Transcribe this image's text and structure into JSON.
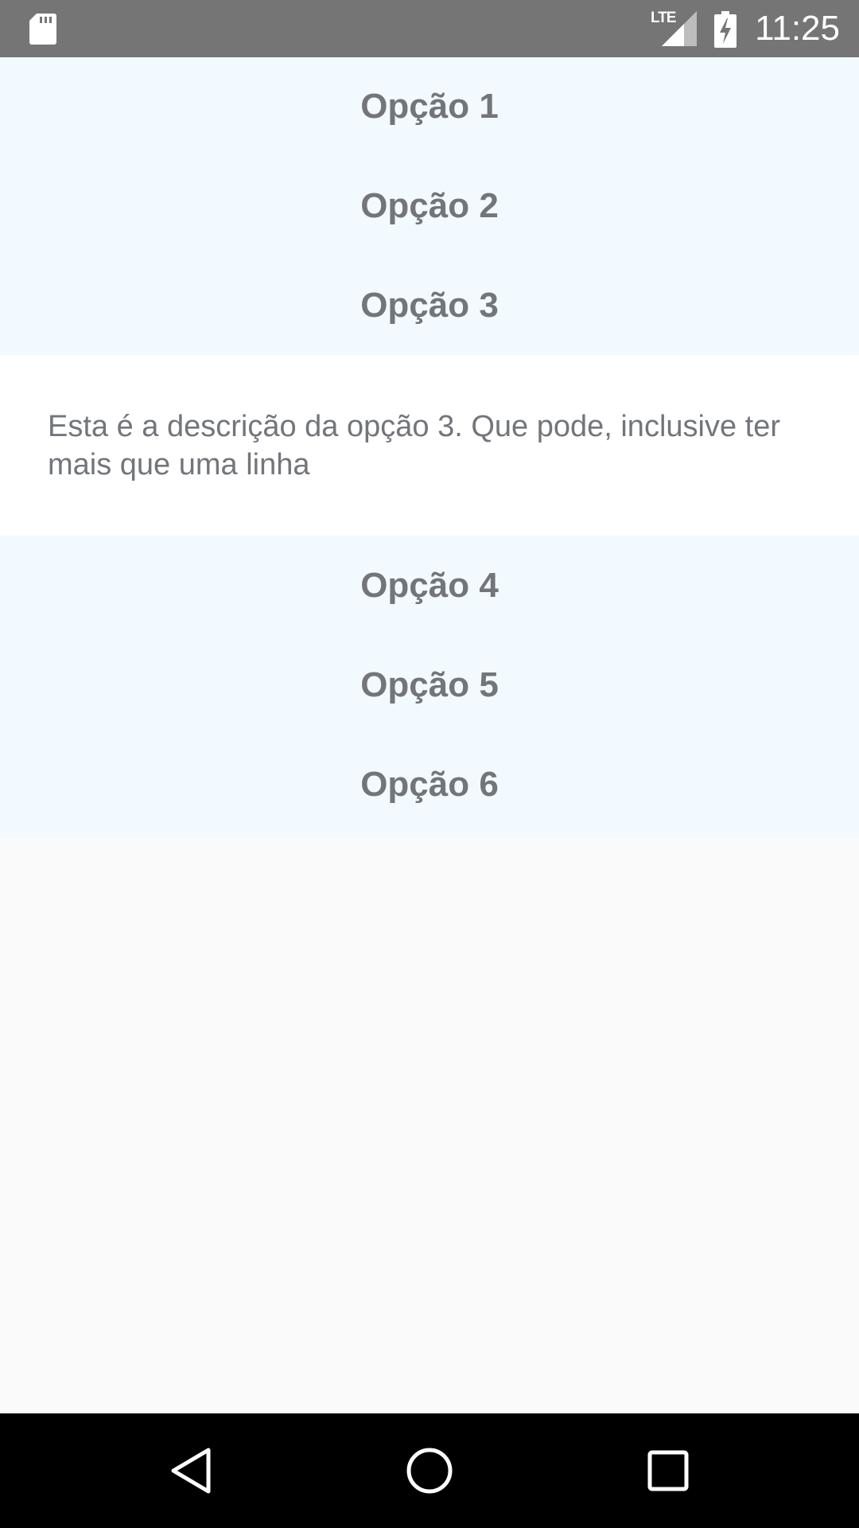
{
  "status_bar": {
    "network_label": "LTE",
    "time": "11:25"
  },
  "options_group_a": [
    {
      "label": "Opção 1"
    },
    {
      "label": "Opção 2"
    },
    {
      "label": "Opção 3"
    }
  ],
  "description": {
    "text": "Esta é a descrição da opção 3. Que pode, inclusive ter mais que uma linha"
  },
  "options_group_b": [
    {
      "label": "Opção 4"
    },
    {
      "label": "Opção 5"
    },
    {
      "label": "Opção 6"
    }
  ],
  "nav_bar": {
    "icons": [
      "back-icon",
      "home-icon",
      "recent-apps-icon"
    ]
  },
  "colors": {
    "status_bar_bg": "#757575",
    "list_bg": "#f3faff",
    "description_bg": "#ffffff",
    "text": "#72767b",
    "nav_bar_bg": "#000000"
  }
}
